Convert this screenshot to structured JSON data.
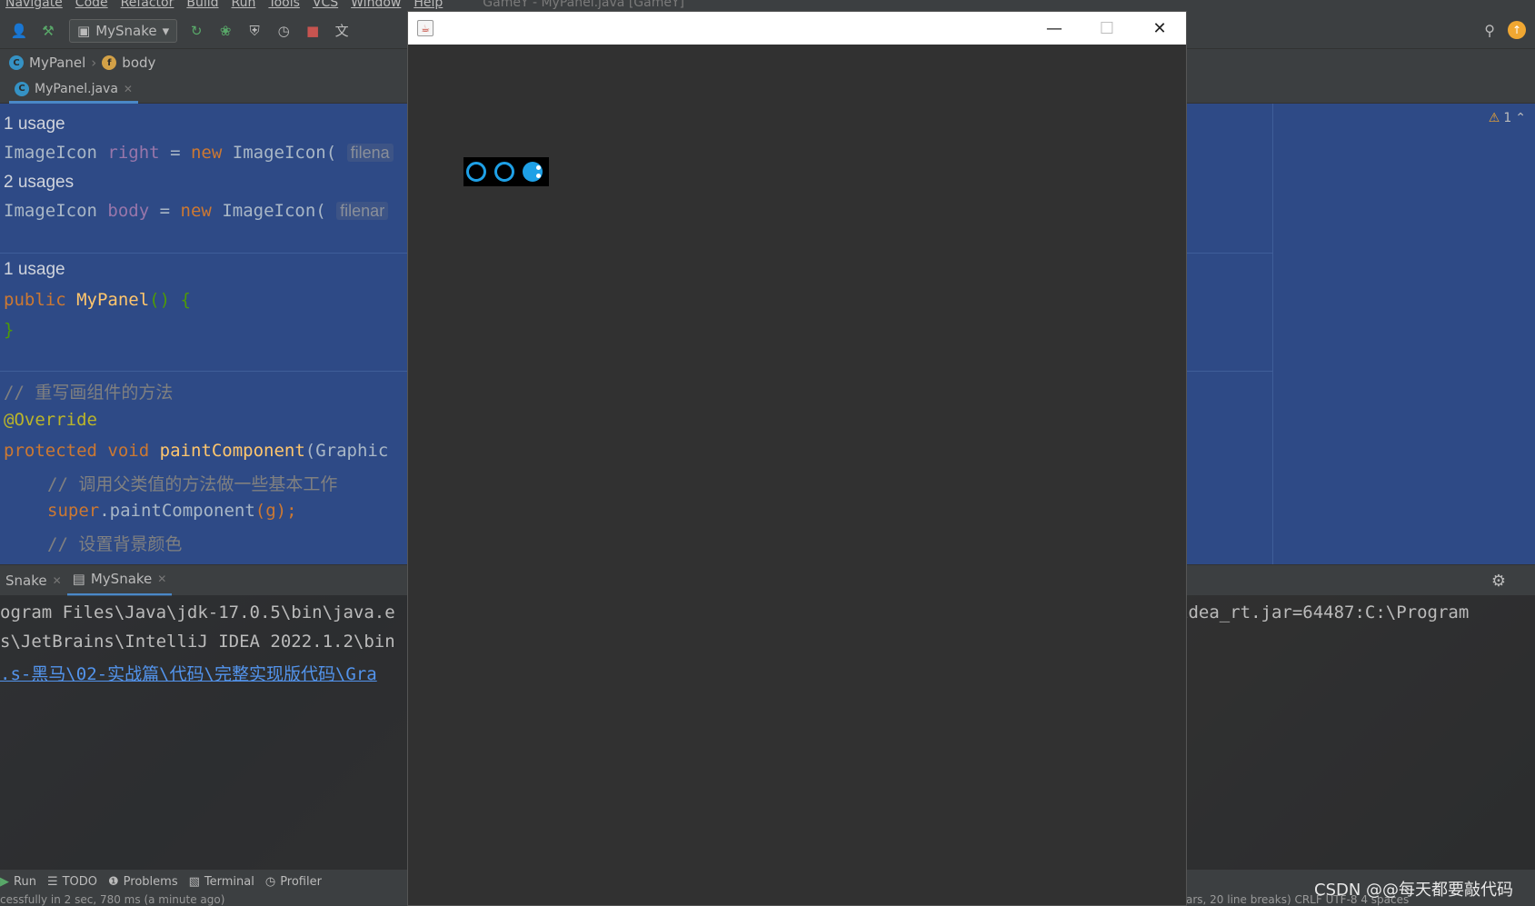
{
  "menu": [
    "Navigate",
    "Code",
    "Refactor",
    "Build",
    "Run",
    "Tools",
    "VCS",
    "Window",
    "Help"
  ],
  "window_title": "GameY - MyPanel.java [GameY]",
  "toolbar": {
    "run_config": "MySnake"
  },
  "breadcrumb": {
    "class": "MyPanel",
    "field": "body"
  },
  "editor_tab": {
    "file": "MyPanel.java"
  },
  "editor": {
    "warning_count": "1",
    "hint1": "1 usage",
    "line1": {
      "type": "ImageIcon",
      "name": "right",
      "op": "=",
      "kw": "new",
      "ctor": "ImageIcon(",
      "param": "filena"
    },
    "hint2": "2 usages",
    "line2": {
      "type": "ImageIcon",
      "name": "body",
      "op": "=",
      "kw": "new",
      "ctor": "ImageIcon(",
      "param": "filenar"
    },
    "hint3": "1 usage",
    "line3": {
      "kw": "public",
      "name": "MyPanel",
      "rest": "() {"
    },
    "line4": "}",
    "comment1": "// 重写画组件的方法",
    "annotation": "@Override",
    "line5": {
      "kw1": "protected",
      "kw2": "void",
      "name": "paintComponent",
      "rest": "(Graphic"
    },
    "comment2": "// 调用父类值的方法做一些基本工作",
    "line6": {
      "kw": "super",
      "call": ".paintComponent",
      "rest": "(g);"
    },
    "comment3": "// 设置背景颜色"
  },
  "run_panel": {
    "tab1": "Snake",
    "tab2": "MySnake",
    "console": [
      "ogram Files\\Java\\jdk-17.0.5\\bin\\java.e",
      "s\\JetBrains\\IntelliJ IDEA 2022.1.2\\bin",
      ".s-黑马\\02-实战篇\\代码\\完整实现版代码\\Gra"
    ],
    "console_right": "idea_rt.jar=64487:C:\\Program"
  },
  "bottom_tools": [
    "Run",
    "TODO",
    "Problems",
    "Terminal",
    "Profiler"
  ],
  "status": {
    "left": "cessfully in 2 sec, 780 ms (a minute ago)",
    "right": "ars, 20 line breaks)  CRLF  UTF-8  4 spaces"
  },
  "watermark": "CSDN @@每天都要敲代码",
  "game_window": {
    "icon": "java-icon",
    "minimize": "—",
    "maximize": "☐",
    "close": "✕"
  },
  "colors": {
    "editor_selection": "#2e4a86",
    "snake": "#1ea0e6",
    "accent": "#4a88c7"
  }
}
